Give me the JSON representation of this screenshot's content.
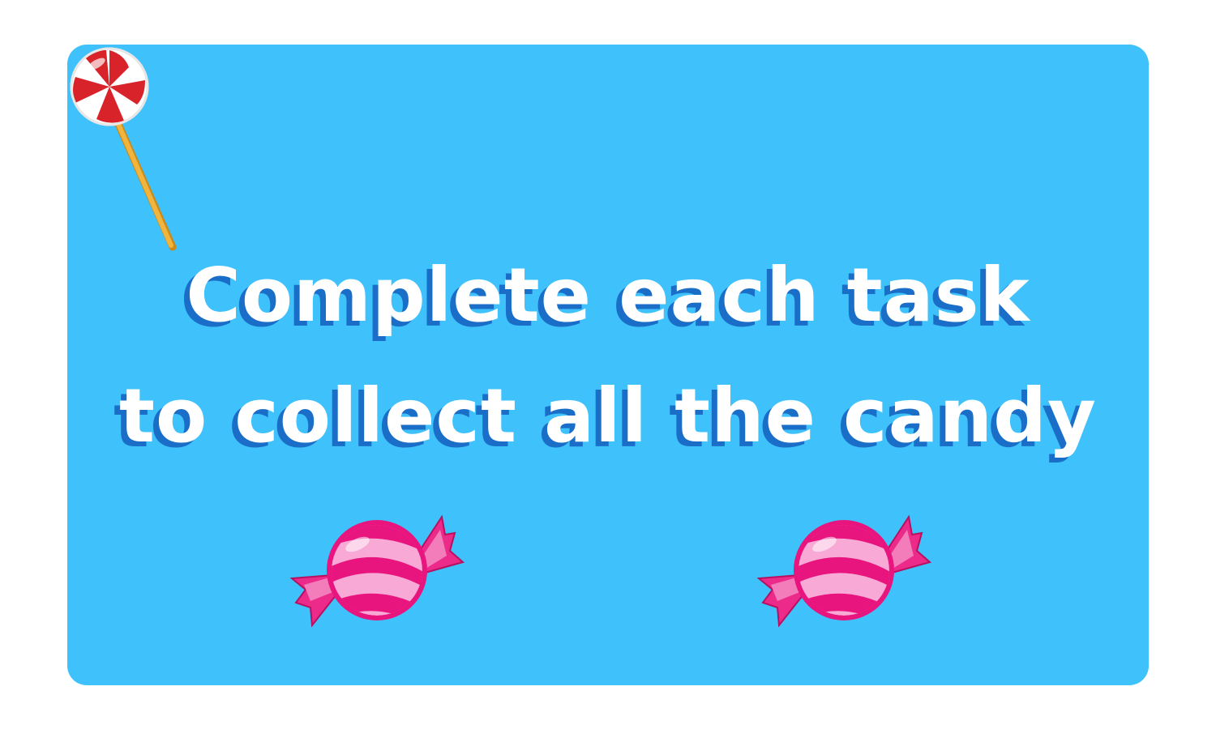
{
  "message": {
    "line1": "Complete each task",
    "line2": "to collect all the candy"
  },
  "colors": {
    "panel": "#3fc1fb",
    "text": "#ffffff",
    "text_shadow": "#1a6ec7",
    "candy_dark": "#e8157f",
    "candy_light": "#f9a9d6",
    "lollipop_red": "#d8232a",
    "stick": "#f1b43c"
  },
  "icons": [
    "wrapped-candy-icon",
    "lollipop-icon",
    "wrapped-candy-icon"
  ]
}
